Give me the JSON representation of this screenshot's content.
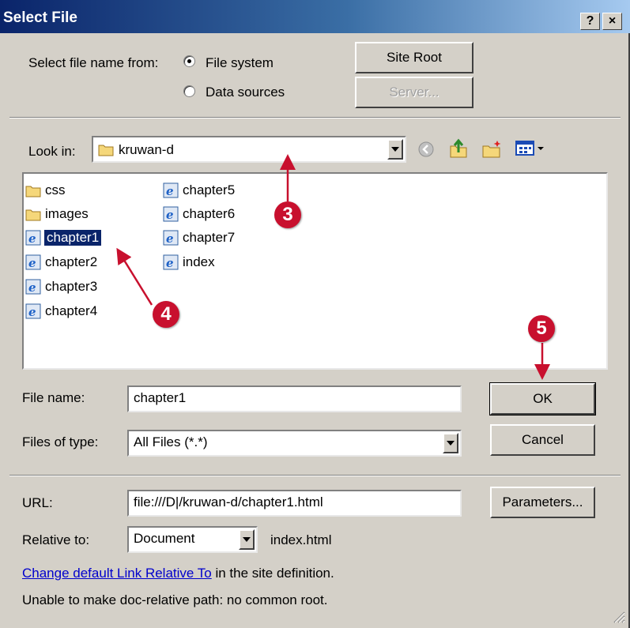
{
  "window": {
    "title": "Select File",
    "help_label": "?",
    "close_label": "×"
  },
  "source": {
    "label": "Select file name from:",
    "options": [
      "File system",
      "Data sources"
    ],
    "selected": "File system",
    "site_root_label": "Site Root",
    "server_label": "Server..."
  },
  "look_in": {
    "label": "Look in:",
    "value": "kruwan-d",
    "toolbar_icons": [
      "back-icon",
      "up-folder-icon",
      "new-folder-icon",
      "view-menu-icon"
    ]
  },
  "files": {
    "column1": [
      {
        "name": "css",
        "type": "folder"
      },
      {
        "name": "images",
        "type": "folder"
      },
      {
        "name": "chapter1",
        "type": "html",
        "selected": true
      },
      {
        "name": "chapter2",
        "type": "html"
      },
      {
        "name": "chapter3",
        "type": "html"
      },
      {
        "name": "chapter4",
        "type": "html"
      }
    ],
    "column2": [
      {
        "name": "chapter5",
        "type": "html"
      },
      {
        "name": "chapter6",
        "type": "html"
      },
      {
        "name": "chapter7",
        "type": "html"
      },
      {
        "name": "index",
        "type": "html"
      }
    ]
  },
  "file_name": {
    "label": "File name:",
    "value": "chapter1"
  },
  "file_type": {
    "label": "Files of type:",
    "value": "All Files (*.*)"
  },
  "buttons": {
    "ok": "OK",
    "cancel": "Cancel",
    "parameters": "Parameters..."
  },
  "url": {
    "label": "URL:",
    "value": "file:///D|/kruwan-d/chapter1.html"
  },
  "relative": {
    "label": "Relative to:",
    "value": "Document",
    "target": "index.html"
  },
  "footer": {
    "link_text": "Change default Link Relative To",
    "link_suffix": " in the site definition.",
    "note": "Unable to make doc-relative path: no common root."
  },
  "annotations": [
    "3",
    "4",
    "5"
  ],
  "colors": {
    "title_start": "#0a246a",
    "title_end": "#a6caf0",
    "face": "#d4d0c8",
    "selection": "#0a246a",
    "annotation": "#c8102e",
    "link": "#0000cc"
  }
}
